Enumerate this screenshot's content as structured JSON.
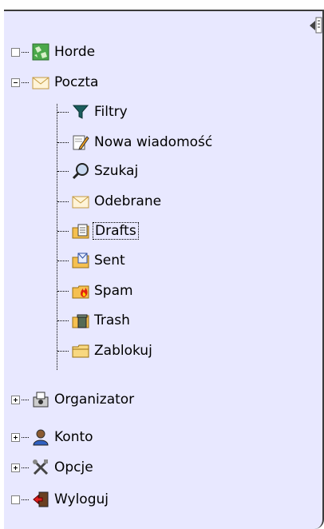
{
  "menu": {
    "items": [
      {
        "label": "Horde",
        "icon": "horde-icon",
        "expander": "empty"
      },
      {
        "label": "Poczta",
        "icon": "mail-icon",
        "expander": "minus"
      },
      {
        "label": "Filtry",
        "icon": "filter-icon",
        "indent": true
      },
      {
        "label": "Nowa wiadomość",
        "icon": "compose-icon",
        "indent": true
      },
      {
        "label": "Szukaj",
        "icon": "search-icon",
        "indent": true
      },
      {
        "label": "Odebrane",
        "icon": "inbox-icon",
        "indent": true
      },
      {
        "label": "Drafts",
        "icon": "drafts-icon",
        "indent": true,
        "selected": true
      },
      {
        "label": "Sent",
        "icon": "sent-icon",
        "indent": true
      },
      {
        "label": "Spam",
        "icon": "spam-icon",
        "indent": true
      },
      {
        "label": "Trash",
        "icon": "trash-icon",
        "indent": true
      },
      {
        "label": "Zablokuj",
        "icon": "folder-icon",
        "indent": true
      },
      {
        "label": "Organizator",
        "icon": "organizer-icon",
        "expander": "plus"
      },
      {
        "label": "Konto",
        "icon": "user-icon",
        "expander": "plus"
      },
      {
        "label": "Opcje",
        "icon": "tools-icon",
        "expander": "plus"
      },
      {
        "label": "Wyloguj",
        "icon": "logout-icon",
        "expander": "empty"
      }
    ]
  },
  "colors": {
    "panel_bg": "#e8e8ff"
  }
}
